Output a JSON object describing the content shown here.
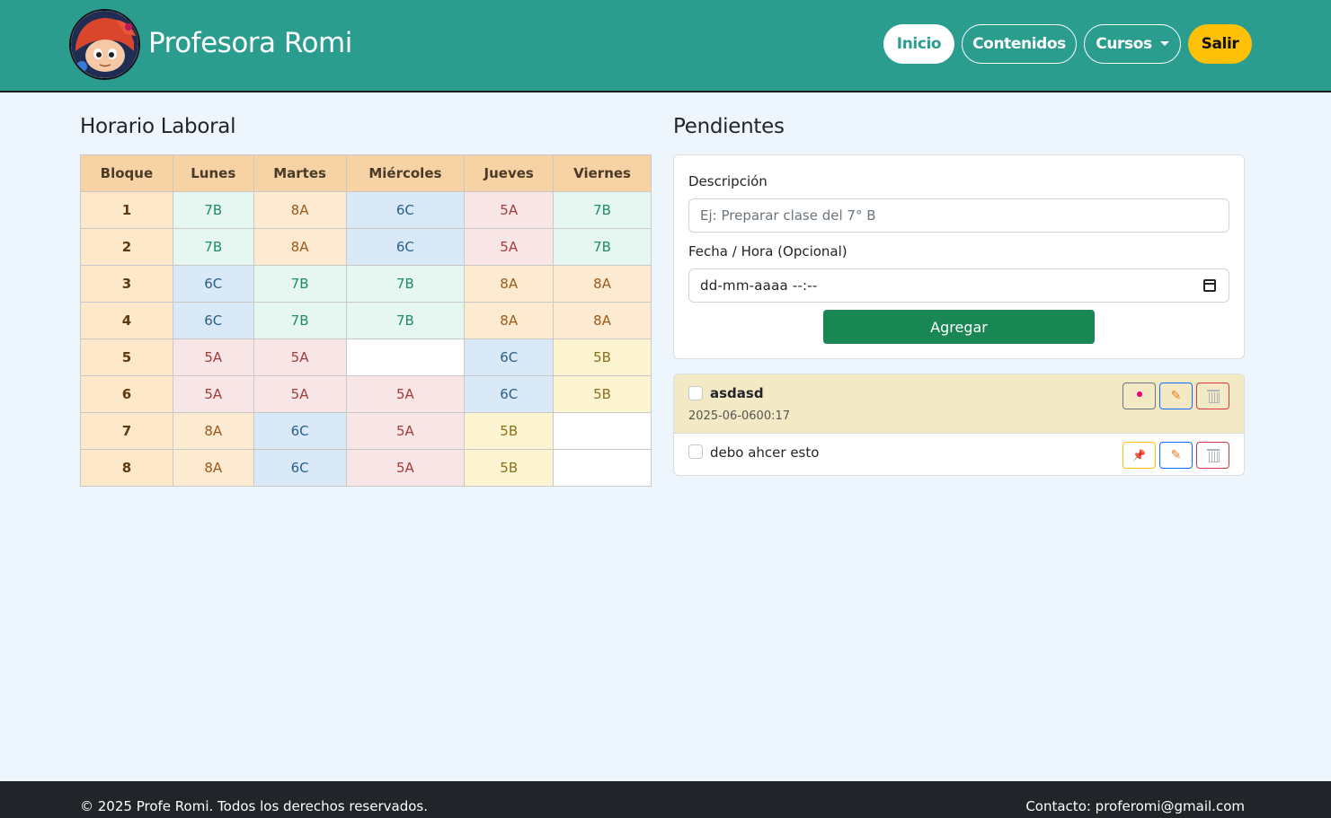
{
  "header": {
    "brand": "Profesora Romi",
    "nav": {
      "inicio": "Inicio",
      "contenidos": "Contenidos",
      "cursos": "Cursos",
      "salir": "Salir"
    },
    "colors": {
      "navbar": "#2a9d8f",
      "active_text": "#2a9d8f",
      "salir_bg": "#ffc107"
    }
  },
  "schedule": {
    "title": "Horario Laboral",
    "headers": [
      "Bloque",
      "Lunes",
      "Martes",
      "Miércoles",
      "Jueves",
      "Viernes"
    ],
    "rows": [
      [
        "1",
        "7B",
        "8A",
        "6C",
        "5A",
        "7B"
      ],
      [
        "2",
        "7B",
        "8A",
        "6C",
        "5A",
        "7B"
      ],
      [
        "3",
        "6C",
        "7B",
        "7B",
        "8A",
        "8A"
      ],
      [
        "4",
        "6C",
        "7B",
        "7B",
        "8A",
        "8A"
      ],
      [
        "5",
        "5A",
        "5A",
        "",
        "6C",
        "5B"
      ],
      [
        "6",
        "5A",
        "5A",
        "5A",
        "6C",
        "5B"
      ],
      [
        "7",
        "8A",
        "6C",
        "5A",
        "5B",
        ""
      ],
      [
        "8",
        "8A",
        "6C",
        "5A",
        "5B",
        ""
      ]
    ]
  },
  "pending": {
    "title": "Pendientes",
    "form": {
      "description_label": "Descripción",
      "description_placeholder": "Ej: Preparar clase del 7° B",
      "datetime_label": "Fecha / Hora (Opcional)",
      "datetime_value": "dd-mm-aaaa --:--",
      "add_label": "Agregar"
    },
    "tasks": [
      {
        "title": "asdasd",
        "date": "2025-06-0600:17",
        "pinned": true
      },
      {
        "title": "debo ahcer esto",
        "date": "",
        "pinned": false
      }
    ]
  },
  "footer": {
    "copyright": "© 2025 Profe Romi. Todos los derechos reservados.",
    "contact": "Contacto: proferomi@gmail.com"
  }
}
